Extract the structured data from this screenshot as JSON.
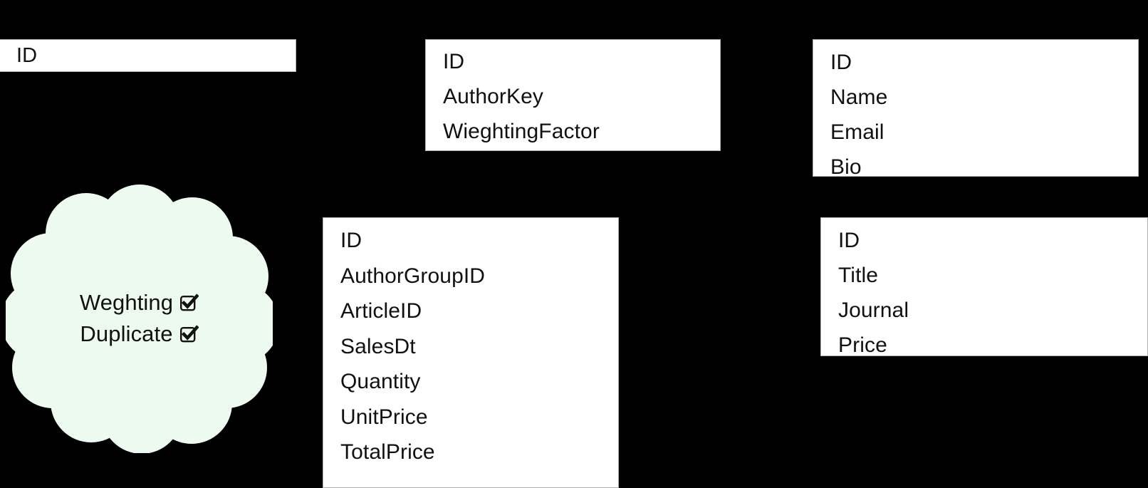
{
  "diagram": {
    "background_color": "#000000",
    "entity_fill_color": "#FFFFFF",
    "entity_border_color": "#B0B0B0",
    "callout_fill_color": "#EDFAEF",
    "text_color": "#111111"
  },
  "entities": [
    {
      "id": "author-id",
      "name": "author-id-entity",
      "fields": [
        "ID"
      ]
    },
    {
      "id": "author-group",
      "name": "author-group-entity",
      "fields": [
        "ID",
        "AuthorKey",
        "WieghtingFactor"
      ]
    },
    {
      "id": "author",
      "name": "author-entity",
      "fields": [
        "ID",
        "Name",
        "Email",
        "Bio"
      ]
    },
    {
      "id": "sales",
      "name": "sales-entity",
      "fields": [
        "ID",
        "AuthorGroupID",
        "ArticleID",
        "SalesDt",
        "Quantity",
        "UnitPrice",
        "TotalPrice"
      ]
    },
    {
      "id": "article",
      "name": "article-entity",
      "fields": [
        "ID",
        "Title",
        "Journal",
        "Price"
      ]
    }
  ],
  "callout": {
    "shape": "cloud",
    "fill_color": "#EDFAEF",
    "options": [
      {
        "label": "Weghting",
        "checkbox": "checked-checkbox-icon",
        "checked": true
      },
      {
        "label": "Duplicate",
        "checkbox": "checked-checkbox-icon",
        "checked": true
      }
    ]
  }
}
